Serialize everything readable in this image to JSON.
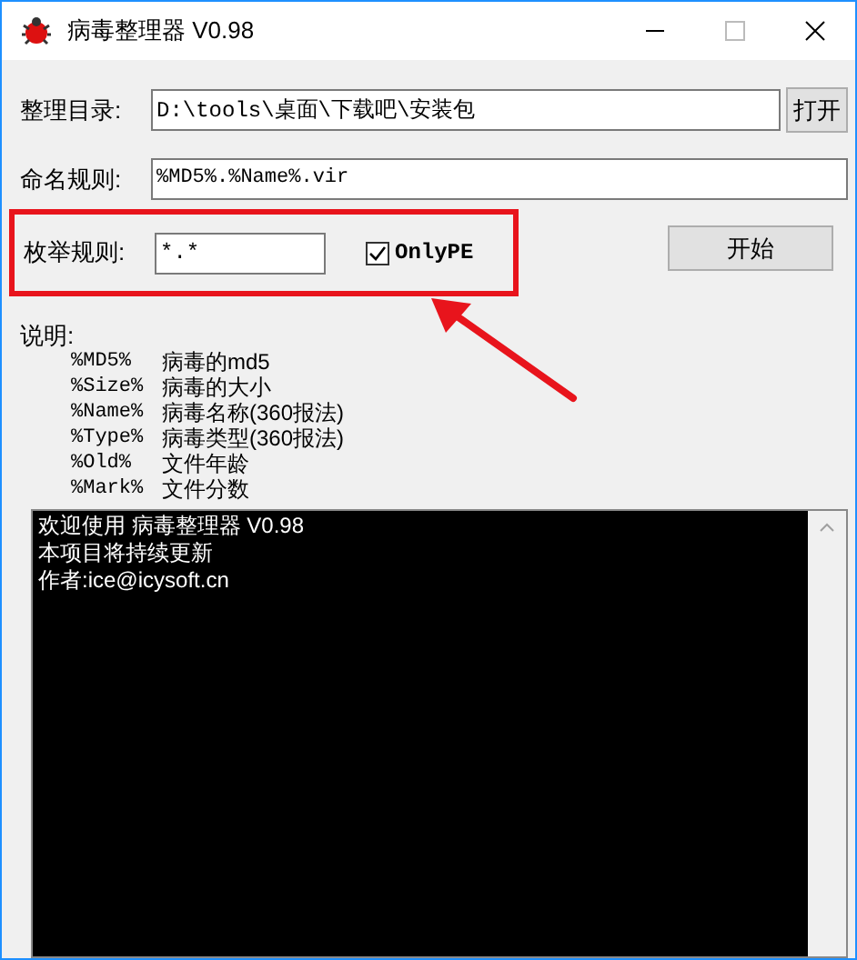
{
  "window": {
    "title": "病毒整理器 V0.98"
  },
  "directory": {
    "label": "整理目录:",
    "value": "D:\\tools\\桌面\\下载吧\\安装包",
    "button": "打开"
  },
  "naming": {
    "label": "命名规则:",
    "value": "%MD5%.%Name%.vir"
  },
  "enumeration": {
    "label": "枚举规则:",
    "value": "*.*",
    "only_pe": {
      "label": "OnlyPE",
      "checked": true
    },
    "button": "开始"
  },
  "help": {
    "label": "说明:",
    "items": [
      {
        "key": "%MD5%",
        "text": "病毒的md5"
      },
      {
        "key": "%Size%",
        "text": "病毒的大小"
      },
      {
        "key": "%Name%",
        "text": "病毒名称(360报法)"
      },
      {
        "key": "%Type%",
        "text": "病毒类型(360报法)"
      },
      {
        "key": "%Old%",
        "text": "文件年龄"
      },
      {
        "key": "%Mark%",
        "text": "文件分数"
      }
    ]
  },
  "console": {
    "lines": [
      "欢迎使用 病毒整理器 V0.98",
      "本项目将持续更新",
      "作者:ice@icysoft.cn"
    ]
  }
}
